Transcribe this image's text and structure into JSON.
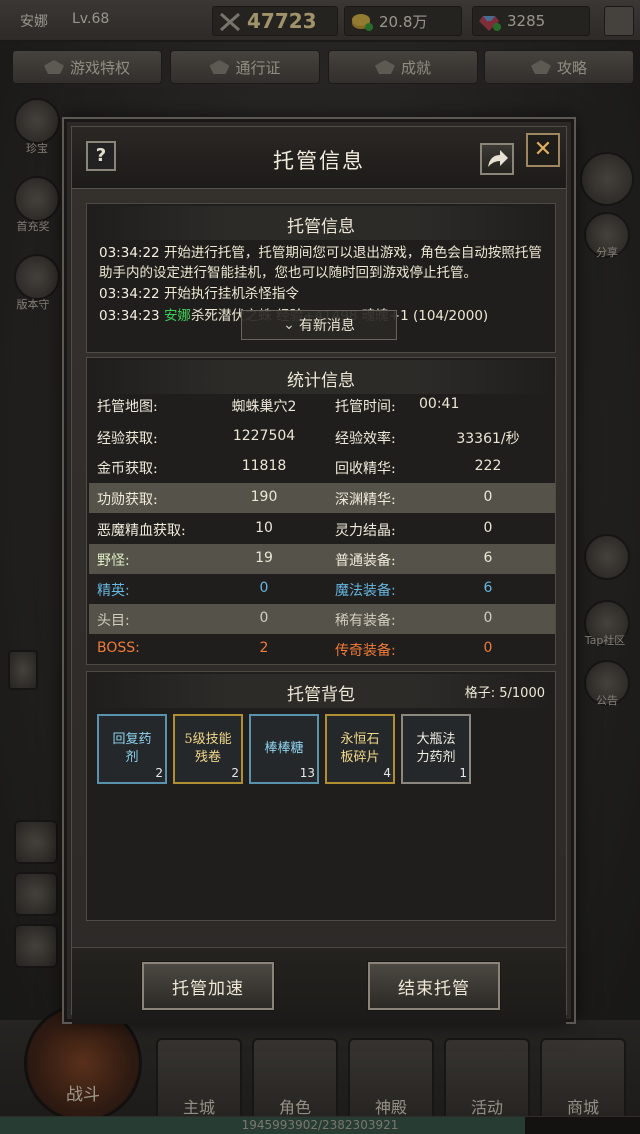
{
  "topbar": {
    "player_name": "安娜",
    "level": "Lv.68",
    "power": "47723",
    "gold": "20.8万",
    "gems": "3285"
  },
  "nav_tabs": [
    "游戏特权",
    "通行证",
    "成就",
    "攻略"
  ],
  "side_left": [
    "珍宝",
    "首充奖",
    "版本守"
  ],
  "side_right": [
    "分享",
    "Tap社区",
    "公告"
  ],
  "bottom_nav": {
    "battle": "战斗",
    "items": [
      "主城",
      "角色",
      "神殿",
      "活动",
      "商城"
    ],
    "exp_text": "1945993902/2382303921",
    "exp_ratio": 0.82
  },
  "modal": {
    "title": "托管信息",
    "help": "?",
    "close": "✕",
    "log_panel": {
      "title": "托管信息",
      "lines": [
        {
          "time": "03:34:22",
          "text": "开始进行托管，托管期间您可以退出游戏，角色会自动按照托管助手内的设定进行智能挂机，您也可以随时回到游戏停止托管。"
        },
        {
          "time": "03:34:22",
          "text": "开始执行挂机杀怪指令"
        },
        {
          "time": "03:34:23",
          "hl": "安娜",
          "text": "杀死潜伏之蛛 经验+41498 魂魄+1 (104/2000)"
        }
      ],
      "new_message": "有新消息"
    },
    "stats_panel": {
      "title": "统计信息",
      "rows": [
        {
          "l1": "托管地图:",
          "v1": "蜘蛛巢穴2",
          "l2": "托管时间:",
          "v2": "00:41"
        },
        {
          "l1": "经验获取:",
          "v1": "1227504",
          "l2": "经验效率:",
          "v2": "33361/秒"
        },
        {
          "l1": "金币获取:",
          "v1": "11818",
          "l2": "回收精华:",
          "v2": "222"
        },
        {
          "l1": "功勋获取:",
          "v1": "190",
          "l2": "深渊精华:",
          "v2": "0"
        },
        {
          "l1": "恶魔精血获取:",
          "v1": "10",
          "l2": "灵力结晶:",
          "v2": "0"
        },
        {
          "l1": "野怪:",
          "v1": "19",
          "l2": "普通装备:",
          "v2": "6"
        },
        {
          "l1": "精英:",
          "v1": "0",
          "l2": "魔法装备:",
          "v2": "6"
        },
        {
          "l1": "头目:",
          "v1": "0",
          "l2": "稀有装备:",
          "v2": "0"
        },
        {
          "l1": "BOSS:",
          "v1": "2",
          "l2": "传奇装备:",
          "v2": "0"
        }
      ]
    },
    "bag_panel": {
      "title": "托管背包",
      "capacity": "格子: 5/1000",
      "items": [
        {
          "name": "回复药剂",
          "count": "2"
        },
        {
          "name": "5级技能残卷",
          "count": "2"
        },
        {
          "name": "棒棒糖",
          "count": "13"
        },
        {
          "name": "永恒石板碎片",
          "count": "4"
        },
        {
          "name": "大瓶法力药剂",
          "count": "1"
        }
      ]
    },
    "buttons": {
      "speed": "托管加速",
      "end": "结束托管"
    }
  },
  "colors": {
    "highlight_green": "#3fcf5a",
    "elite_blue": "#66b6e0",
    "boss_orange": "#ef7b3a",
    "item_gold_border": "#b08f33",
    "item_blue_border": "#5892ad"
  }
}
